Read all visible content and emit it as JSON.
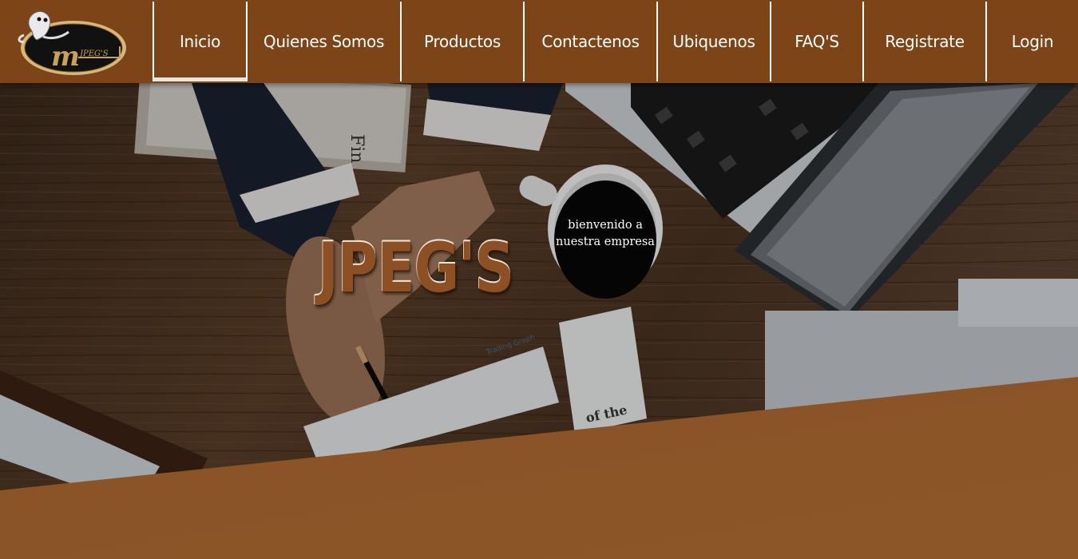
{
  "brand": {
    "logo_text": "JPEG'S",
    "colors": {
      "nav_bg": "#7d4517",
      "accent": "#8b5426",
      "nav_text": "#ffffff"
    }
  },
  "nav": {
    "items": [
      {
        "label": "Inicio",
        "active": true
      },
      {
        "label": "Quienes Somos"
      },
      {
        "label": "Productos"
      },
      {
        "label": "Contactenos"
      },
      {
        "label": "Ubiquenos"
      },
      {
        "label": "FAQ'S"
      },
      {
        "label": "Registrate"
      },
      {
        "label": "Login"
      }
    ]
  },
  "hero": {
    "title": "JPEG'S",
    "welcome_line1": "bienvenido a",
    "welcome_line2": "nuestra empresa",
    "background_icon": "office-desk-photo"
  }
}
